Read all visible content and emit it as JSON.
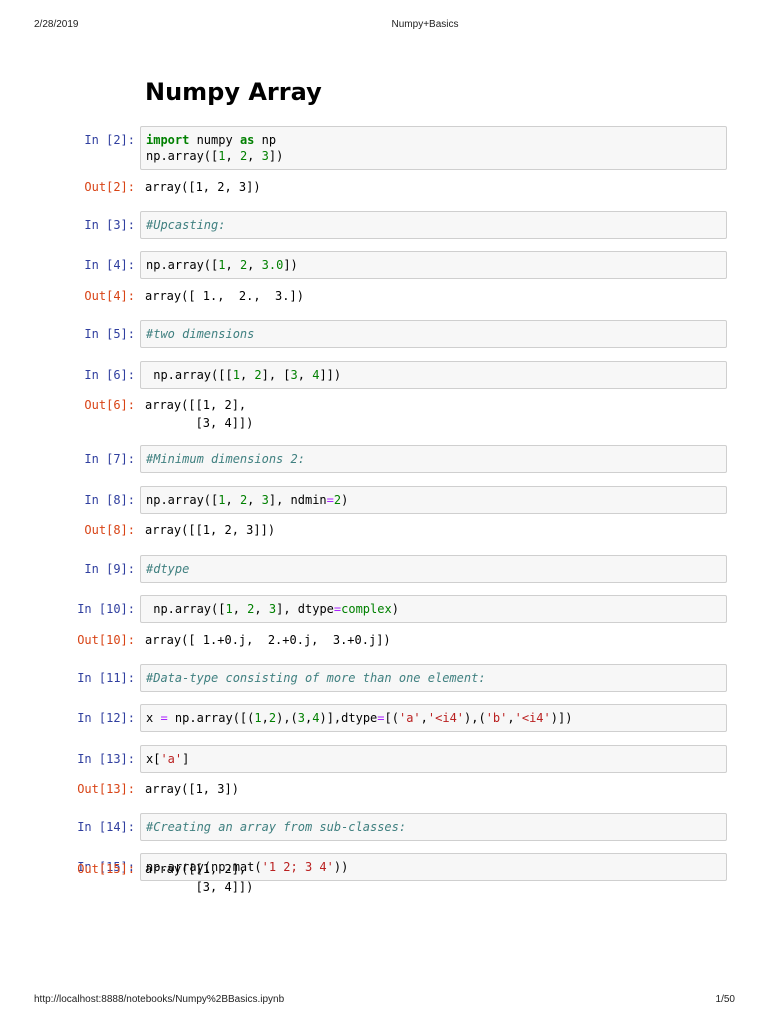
{
  "header": {
    "date": "2/28/2019",
    "title": "Numpy+Basics"
  },
  "footer": {
    "url": "http://localhost:8888/notebooks/Numpy%2BBasics.ipynb",
    "page": "1/50"
  },
  "notebook_title": "Numpy Array",
  "cells": [
    {
      "in_prompt": "In [2]:",
      "input": [
        [
          [
            "import",
            "kw"
          ],
          [
            " numpy ",
            ""
          ],
          [
            "as",
            "kw"
          ],
          [
            " np",
            ""
          ]
        ],
        [
          [
            "np.array([",
            ""
          ],
          [
            "1",
            "num"
          ],
          [
            ", ",
            ""
          ],
          [
            "2",
            "num"
          ],
          [
            ", ",
            ""
          ],
          [
            "3",
            "num"
          ],
          [
            "])",
            ""
          ]
        ]
      ],
      "out_prompt": "Out[2]:",
      "output": [
        "array([1, 2, 3])"
      ]
    },
    {
      "in_prompt": "In [3]:",
      "input": [
        [
          [
            "#Upcasting:",
            "cm"
          ]
        ]
      ]
    },
    {
      "in_prompt": "In [4]:",
      "input": [
        [
          [
            "np.array([",
            ""
          ],
          [
            "1",
            "num"
          ],
          [
            ", ",
            ""
          ],
          [
            "2",
            "num"
          ],
          [
            ", ",
            ""
          ],
          [
            "3.0",
            "num"
          ],
          [
            "])",
            ""
          ]
        ]
      ],
      "out_prompt": "Out[4]:",
      "output": [
        "array([ 1.,  2.,  3.])"
      ]
    },
    {
      "in_prompt": "In [5]:",
      "input": [
        [
          [
            "#two dimensions",
            "cm"
          ]
        ]
      ]
    },
    {
      "in_prompt": "In [6]:",
      "input": [
        [
          [
            " np.array([[",
            ""
          ],
          [
            "1",
            "num"
          ],
          [
            ", ",
            ""
          ],
          [
            "2",
            "num"
          ],
          [
            "], [",
            ""
          ],
          [
            "3",
            "num"
          ],
          [
            ", ",
            ""
          ],
          [
            "4",
            "num"
          ],
          [
            "]])",
            ""
          ]
        ]
      ],
      "out_prompt": "Out[6]:",
      "output": [
        "array([[1, 2],",
        "       [3, 4]])"
      ]
    },
    {
      "in_prompt": "In [7]:",
      "input": [
        [
          [
            "#Minimum dimensions 2:",
            "cm"
          ]
        ]
      ]
    },
    {
      "in_prompt": "In [8]:",
      "input": [
        [
          [
            "np.array([",
            ""
          ],
          [
            "1",
            "num"
          ],
          [
            ", ",
            ""
          ],
          [
            "2",
            "num"
          ],
          [
            ", ",
            ""
          ],
          [
            "3",
            "num"
          ],
          [
            "], ndmin",
            ""
          ],
          [
            "=",
            "op"
          ],
          [
            "2",
            "num"
          ],
          [
            ")",
            ""
          ]
        ]
      ],
      "out_prompt": "Out[8]:",
      "output": [
        "array([[1, 2, 3]])"
      ]
    },
    {
      "in_prompt": "In [9]:",
      "input": [
        [
          [
            "#dtype",
            "cm"
          ]
        ]
      ]
    },
    {
      "in_prompt": "In [10]:",
      "input": [
        [
          [
            " np.array([",
            ""
          ],
          [
            "1",
            "num"
          ],
          [
            ", ",
            ""
          ],
          [
            "2",
            "num"
          ],
          [
            ", ",
            ""
          ],
          [
            "3",
            "num"
          ],
          [
            "], dtype",
            ""
          ],
          [
            "=",
            "op"
          ],
          [
            "complex",
            "bi"
          ],
          [
            ")",
            ""
          ]
        ]
      ],
      "out_prompt": "Out[10]:",
      "output": [
        "array([ 1.+0.j,  2.+0.j,  3.+0.j])"
      ]
    },
    {
      "in_prompt": "In [11]:",
      "input": [
        [
          [
            "#Data-type consisting of more than one element:",
            "cm"
          ]
        ]
      ]
    },
    {
      "in_prompt": "In [12]:",
      "input": [
        [
          [
            "x ",
            ""
          ],
          [
            "=",
            "op"
          ],
          [
            " np.array([(",
            ""
          ],
          [
            "1",
            "num"
          ],
          [
            ",",
            ""
          ],
          [
            "2",
            "num"
          ],
          [
            "),(",
            ""
          ],
          [
            "3",
            "num"
          ],
          [
            ",",
            ""
          ],
          [
            "4",
            "num"
          ],
          [
            ")],dtype",
            ""
          ],
          [
            "=",
            "op"
          ],
          [
            "[(",
            ""
          ],
          [
            "'a'",
            "str"
          ],
          [
            ",",
            ""
          ],
          [
            "'<i4'",
            "str"
          ],
          [
            "),(",
            ""
          ],
          [
            "'b'",
            "str"
          ],
          [
            ",",
            ""
          ],
          [
            "'<i4'",
            "str"
          ],
          [
            ")])",
            ""
          ]
        ]
      ]
    },
    {
      "in_prompt": "In [13]:",
      "input": [
        [
          [
            "x[",
            ""
          ],
          [
            "'a'",
            "str"
          ],
          [
            "]",
            ""
          ]
        ]
      ],
      "out_prompt": "Out[13]:",
      "output": [
        "array([1, 3])"
      ]
    },
    {
      "in_prompt": "In [14]:",
      "input": [
        [
          [
            "#Creating an array from sub-classes:",
            "cm"
          ]
        ]
      ]
    },
    {
      "in_prompt": "In [15]:",
      "input": [
        [
          [
            "np.array(np.mat(",
            ""
          ],
          [
            "'1 2; 3 4'",
            "str"
          ],
          [
            "))",
            ""
          ]
        ]
      ],
      "out_prompt": "Out[15]:",
      "output": [
        "array([[1, 2],",
        "       [3, 4]])"
      ]
    }
  ]
}
